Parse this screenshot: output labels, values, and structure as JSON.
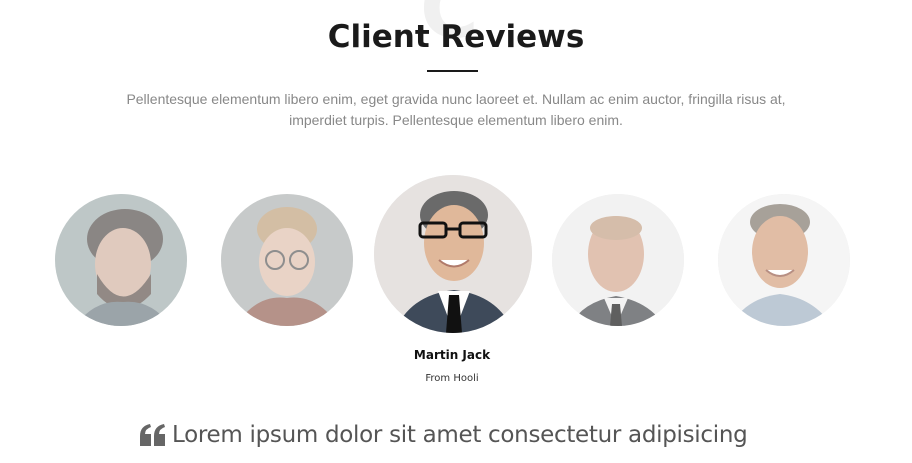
{
  "section": {
    "bg_letter": "C",
    "title": "Client Reviews",
    "intro": "Pellentesque elementum libero enim, eget gravida nunc laoreet et. Nullam ac enim auctor, fringilla risus at, imperdiet turpis. Pellentesque elementum libero enim."
  },
  "active_reviewer": {
    "name": "Martin Jack",
    "company": "From Hooli"
  },
  "quote": {
    "icon": "quote-icon",
    "text": "Lorem ipsum dolor sit amet consectetur adipisicing"
  },
  "colors": {
    "title": "#1a1a1a",
    "body_text": "#888888",
    "quote_text": "#555555",
    "quote_icon": "#666666"
  }
}
